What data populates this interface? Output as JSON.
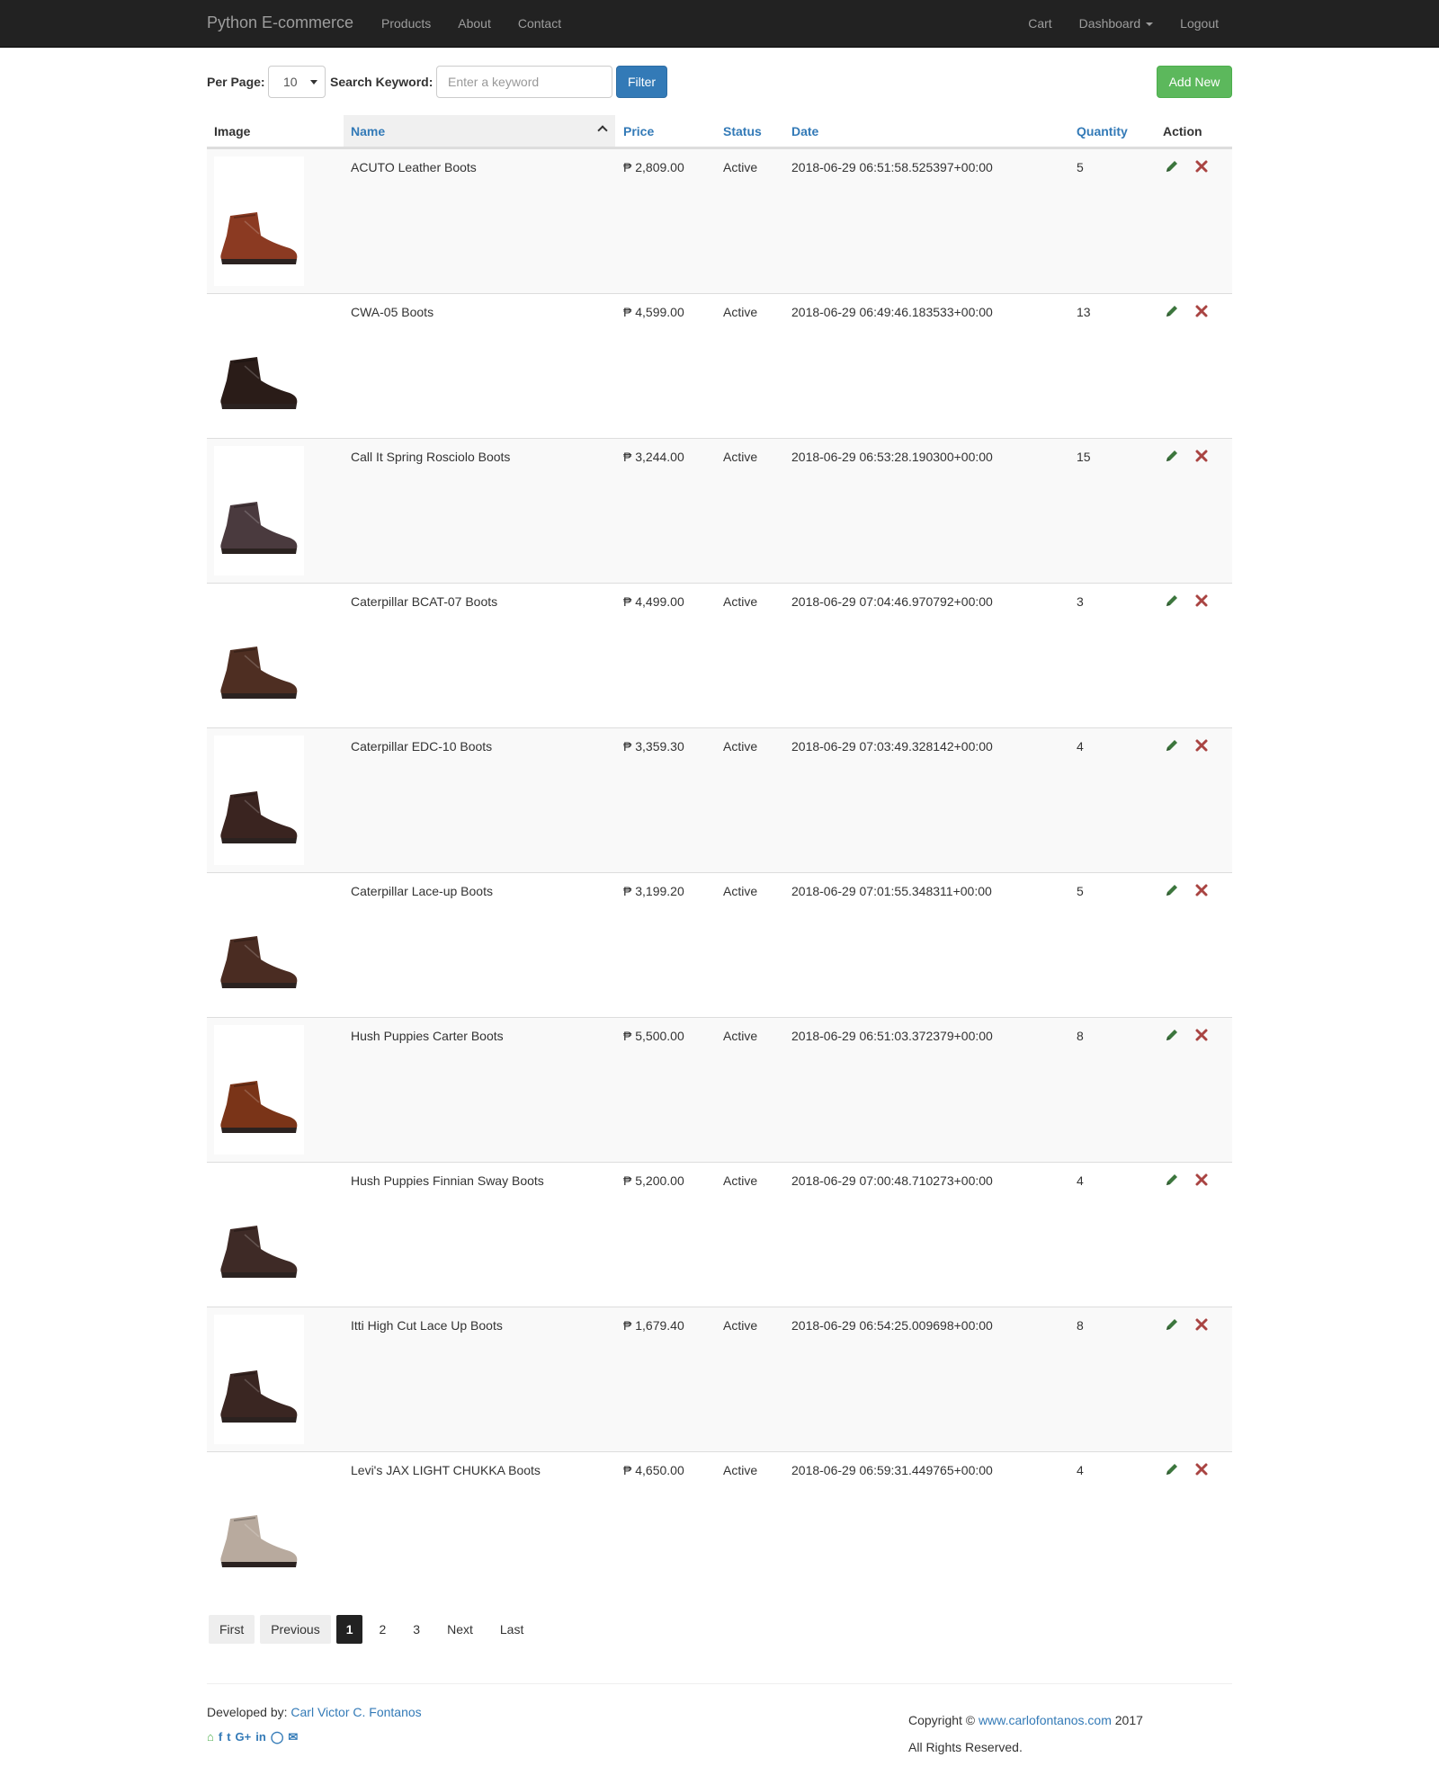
{
  "navbar": {
    "brand": "Python E-commerce",
    "left_links": [
      "Products",
      "About",
      "Contact"
    ],
    "cart": "Cart",
    "dashboard": "Dashboard",
    "logout": "Logout"
  },
  "toolbar": {
    "per_page_label": "Per Page:",
    "per_page_value": "10",
    "search_label": "Search Keyword:",
    "search_placeholder": "Enter a keyword",
    "filter_label": "Filter",
    "add_new_label": "Add New"
  },
  "table": {
    "headers": {
      "image": "Image",
      "name": "Name",
      "price": "Price",
      "status": "Status",
      "date": "Date",
      "quantity": "Quantity",
      "action": "Action"
    },
    "rows": [
      {
        "name": "ACUTO Leather Boots",
        "price": "₱ 2,809.00",
        "status": "Active",
        "date": "2018-06-29 06:51:58.525397+00:00",
        "quantity": "5",
        "shoe_color": "#8b3a22"
      },
      {
        "name": "CWA-05 Boots",
        "price": "₱ 4,599.00",
        "status": "Active",
        "date": "2018-06-29 06:49:46.183533+00:00",
        "quantity": "13",
        "shoe_color": "#2a1c18"
      },
      {
        "name": "Call It Spring Rosciolo Boots",
        "price": "₱ 3,244.00",
        "status": "Active",
        "date": "2018-06-29 06:53:28.190300+00:00",
        "quantity": "15",
        "shoe_color": "#4a3a3e"
      },
      {
        "name": "Caterpillar BCAT-07 Boots",
        "price": "₱ 4,499.00",
        "status": "Active",
        "date": "2018-06-29 07:04:46.970792+00:00",
        "quantity": "3",
        "shoe_color": "#4e2e22"
      },
      {
        "name": "Caterpillar EDC-10 Boots",
        "price": "₱ 3,359.30",
        "status": "Active",
        "date": "2018-06-29 07:03:49.328142+00:00",
        "quantity": "4",
        "shoe_color": "#3a2420"
      },
      {
        "name": "Caterpillar Lace-up Boots",
        "price": "₱ 3,199.20",
        "status": "Active",
        "date": "2018-06-29 07:01:55.348311+00:00",
        "quantity": "5",
        "shoe_color": "#4a2c22"
      },
      {
        "name": "Hush Puppies Carter Boots",
        "price": "₱ 5,500.00",
        "status": "Active",
        "date": "2018-06-29 06:51:03.372379+00:00",
        "quantity": "8",
        "shoe_color": "#7a3418"
      },
      {
        "name": "Hush Puppies Finnian Sway Boots",
        "price": "₱ 5,200.00",
        "status": "Active",
        "date": "2018-06-29 07:00:48.710273+00:00",
        "quantity": "4",
        "shoe_color": "#3e2a26"
      },
      {
        "name": "Itti High Cut Lace Up Boots",
        "price": "₱ 1,679.40",
        "status": "Active",
        "date": "2018-06-29 06:54:25.009698+00:00",
        "quantity": "8",
        "shoe_color": "#3a2622"
      },
      {
        "name": "Levi's JAX LIGHT CHUKKA Boots",
        "price": "₱ 4,650.00",
        "status": "Active",
        "date": "2018-06-29 06:59:31.449765+00:00",
        "quantity": "4",
        "shoe_color": "#b8aa9e"
      }
    ]
  },
  "pagination": {
    "first": "First",
    "previous": "Previous",
    "pages": [
      "1",
      "2",
      "3"
    ],
    "next": "Next",
    "last": "Last"
  },
  "footer": {
    "developed_by": "Developed by:",
    "developer": "Carl Victor C. Fontanos",
    "copyright": "Copyright ©",
    "site": "www.carlofontanos.com",
    "year": "2017",
    "rights": "All Rights Reserved."
  },
  "colors": {
    "navbar_bg": "#222222",
    "link": "#337ab7",
    "success": "#5cb85c",
    "edit_icon": "#3c763d",
    "delete_icon": "#a94442"
  }
}
